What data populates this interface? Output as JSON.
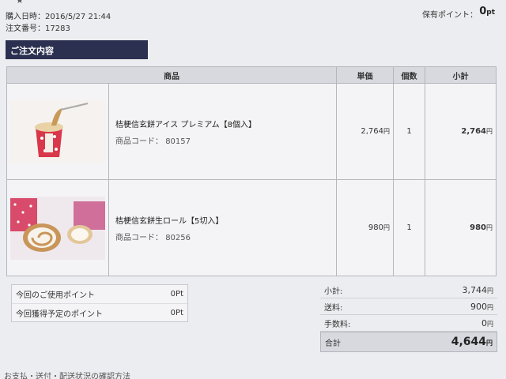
{
  "header": {
    "star_glyph": "★",
    "purchase_date_label": "購入日時：",
    "purchase_date": "2016/5/27 21:44",
    "order_no_label": "注文番号：",
    "order_no": "17283",
    "points_label": "保有ポイント：",
    "points_value": "0",
    "points_unit": "pt"
  },
  "section": {
    "title": "ご注文内容"
  },
  "table": {
    "headers": [
      "商品",
      "単価",
      "個数",
      "小計"
    ],
    "items": [
      {
        "image_icon": "ice-cream-cup-image",
        "name": "桔梗信玄餅アイス プレミアム【8個入】",
        "code_label": "商品コード：",
        "code": "80157",
        "unit_price": "2,764",
        "qty": "1",
        "subtotal": "2,764"
      },
      {
        "image_icon": "roll-cake-image",
        "name": "桔梗信玄餅生ロール【5切入】",
        "code_label": "商品コード：",
        "code": "80256",
        "unit_price": "980",
        "qty": "1",
        "subtotal": "980"
      }
    ],
    "yen": "円"
  },
  "points_box": {
    "used_label": "今回のご使用ポイント",
    "used_value": "0",
    "earned_label": "今回獲得予定のポイント",
    "earned_value": "0",
    "unit": "Pt"
  },
  "totals": {
    "subtotal_label": "小計:",
    "subtotal": "3,744",
    "shipping_label": "送料:",
    "shipping": "900",
    "fee_label": "手数料:",
    "fee": "0",
    "total_label": "合計",
    "total": "4,644",
    "yen": "円"
  },
  "footer": {
    "links_text": "お支払・送付・配送状況の確認方法"
  }
}
